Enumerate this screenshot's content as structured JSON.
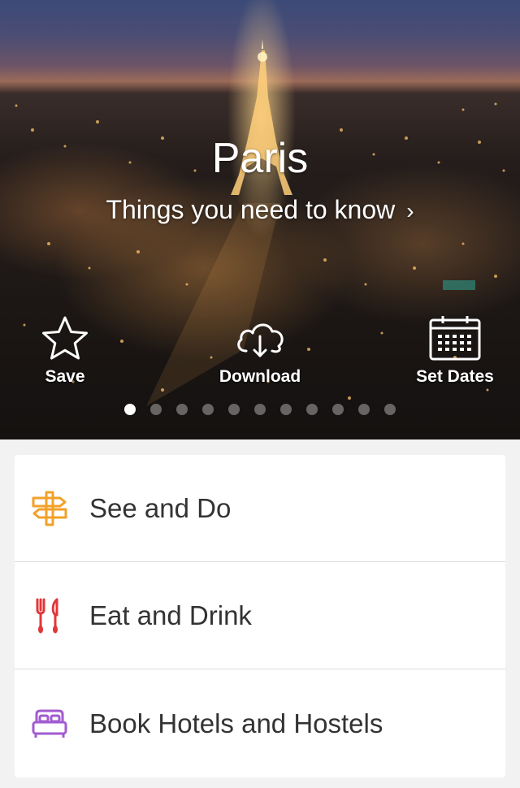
{
  "hero": {
    "title": "Paris",
    "subtitle": "Things you need to know",
    "subtitle_chevron": "›"
  },
  "actions": [
    {
      "label": "Save",
      "icon": "star-icon"
    },
    {
      "label": "Download",
      "icon": "cloud-download-icon"
    },
    {
      "label": "Set Dates",
      "icon": "calendar-icon"
    }
  ],
  "carousel": {
    "total": 11,
    "active_index": 0
  },
  "menu": [
    {
      "label": "See and Do",
      "icon": "signpost-icon",
      "color": "#f2a12a"
    },
    {
      "label": "Eat and Drink",
      "icon": "fork-knife-icon",
      "color": "#e0373a"
    },
    {
      "label": "Book Hotels and Hostels",
      "icon": "bed-icon",
      "color": "#a25bd0"
    }
  ]
}
